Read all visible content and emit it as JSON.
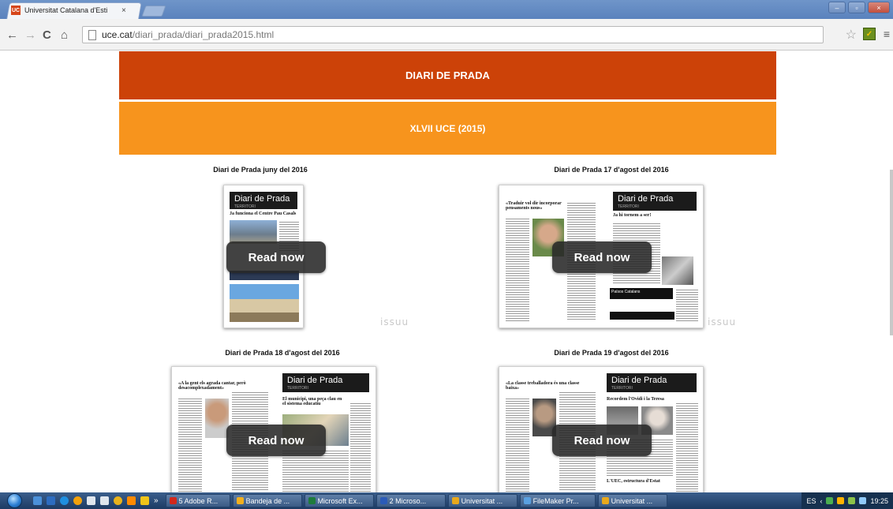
{
  "browser": {
    "tab_title": "Universitat Catalana d'Esti",
    "favicon_text": "UC",
    "tab_close": "×",
    "url_host": "uce.cat",
    "url_path": "/diari_prada/diari_prada2015.html",
    "icons": [
      "back-icon",
      "forward-icon",
      "reload-icon",
      "home-icon",
      "page-icon",
      "star-icon",
      "extension-icon",
      "menu-icon"
    ]
  },
  "window_controls": {
    "minimize": "–",
    "maximize": "▫",
    "close": "×"
  },
  "page": {
    "banner_title": "DIARI DE PRADA",
    "banner_subtitle": "XLVII UCE (2015)",
    "colors": {
      "banner_dark": "#cc4208",
      "banner_light": "#f7941d"
    },
    "items": [
      {
        "title": "Diari de Prada juny del 2016",
        "masthead": "Diari de Prada",
        "masthead_sub": "TERRITORI",
        "headline": "Ja funciona el Centre Pau Casals",
        "button": "Read now",
        "watermark": "issuu"
      },
      {
        "title": "Diari de Prada 17 d'agost del 2016",
        "masthead": "Diari de Prada",
        "masthead_sub": "TERRITORI",
        "headline_left": "«Traduir vol dir incorporar pensaments nous»",
        "headline": "Ja hi tornem a ser!",
        "photo_caption": "Països Catalans",
        "button": "Read now",
        "watermark": "issuu"
      },
      {
        "title": "Diari de Prada 18 d'agost del 2016",
        "masthead": "Diari de Prada",
        "masthead_sub": "TERRITORI",
        "headline_left": "«A la gent els agrada cantar, però desacomplexadament»",
        "headline": "El municipi, una peça clau en el sistema educatiu",
        "button": "Read now"
      },
      {
        "title": "Diari de Prada 19 d'agost del 2016",
        "masthead": "Diari de Prada",
        "masthead_sub": "TERRITORI",
        "headline_left": "«La classe treballadora és una classe baixa»",
        "headline": "Recordem l'Ovidi i la Teresa",
        "footer_headline": "L'UEC, estructura d'Estat",
        "button": "Read now"
      }
    ]
  },
  "taskbar": {
    "overflow": "»",
    "tasks": [
      {
        "label": "5 Adobe R...",
        "color": "#d2281c"
      },
      {
        "label": "Bandeja de ...",
        "color": "#f2b01e"
      },
      {
        "label": "Microsoft Ex...",
        "color": "#1e7b3c"
      },
      {
        "label": "2 Microso...",
        "color": "#2b5bb8"
      },
      {
        "label": "Universitat ...",
        "color": "#e8a81c"
      },
      {
        "label": "FileMaker Pr...",
        "color": "#5aa0e0"
      },
      {
        "label": "Universitat ...",
        "color": "#e8a81c"
      }
    ],
    "language": "ES",
    "clock": "19:25"
  }
}
